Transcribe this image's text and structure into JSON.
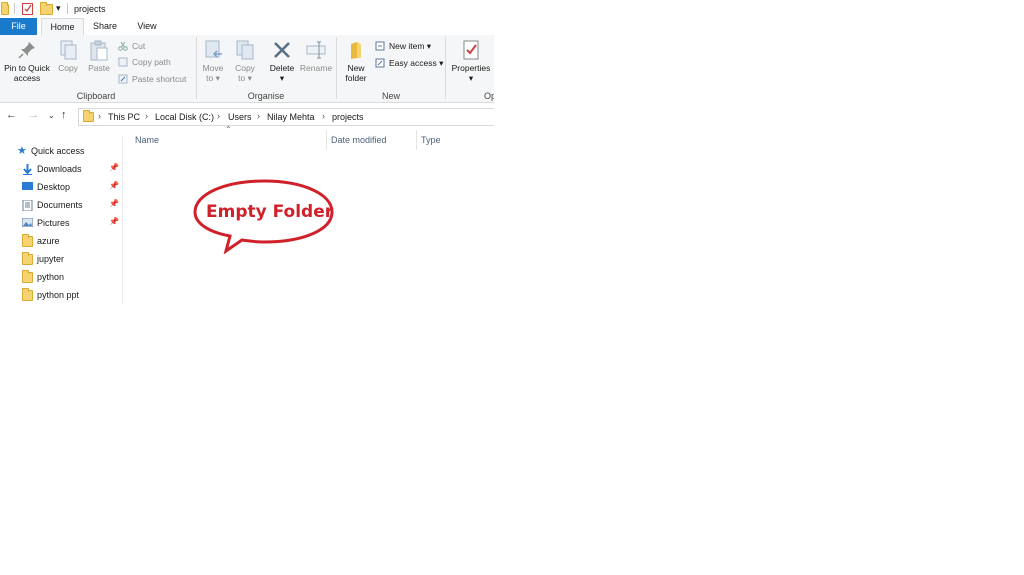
{
  "window": {
    "title": "projects"
  },
  "ribbon_tabs": [
    "File",
    "Home",
    "Share",
    "View"
  ],
  "clipboard": {
    "pin_label_1": "Pin to Quick",
    "pin_label_2": "access",
    "copy": "Copy",
    "paste": "Paste",
    "cut": "Cut",
    "copy_path": "Copy path",
    "paste_shortcut": "Paste shortcut",
    "group": "Clipboard"
  },
  "organise": {
    "move_1": "Move",
    "move_2": "to",
    "copy_1": "Copy",
    "copy_2": "to",
    "delete": "Delete",
    "rename": "Rename",
    "group": "Organise"
  },
  "new": {
    "folder_1": "New",
    "folder_2": "folder",
    "new_item": "New item",
    "easy_access": "Easy access",
    "group": "New"
  },
  "open": {
    "properties": "Properties",
    "group_partial": "Op"
  },
  "breadcrumb": [
    "This PC",
    "Local Disk (C:)",
    "Users",
    "Nilay Mehta",
    "projects"
  ],
  "columns": [
    "Name",
    "Date modified",
    "Type"
  ],
  "nav": {
    "quick_access": "Quick access",
    "items": [
      {
        "label": "Downloads",
        "pinned": true,
        "icon": "download-icon"
      },
      {
        "label": "Desktop",
        "pinned": true,
        "icon": "desktop-icon"
      },
      {
        "label": "Documents",
        "pinned": true,
        "icon": "documents-icon"
      },
      {
        "label": "Pictures",
        "pinned": true,
        "icon": "pictures-icon"
      },
      {
        "label": "azure",
        "pinned": false,
        "icon": "folder-icon"
      },
      {
        "label": "jupyter",
        "pinned": false,
        "icon": "folder-icon"
      },
      {
        "label": "python",
        "pinned": false,
        "icon": "folder-icon"
      },
      {
        "label": "python ppt",
        "pinned": false,
        "icon": "folder-icon"
      }
    ]
  },
  "annotation": {
    "text": "Empty Folder",
    "color": "#d0202a"
  },
  "colors": {
    "accent": "#1979ca",
    "folder": "#f6d371"
  }
}
